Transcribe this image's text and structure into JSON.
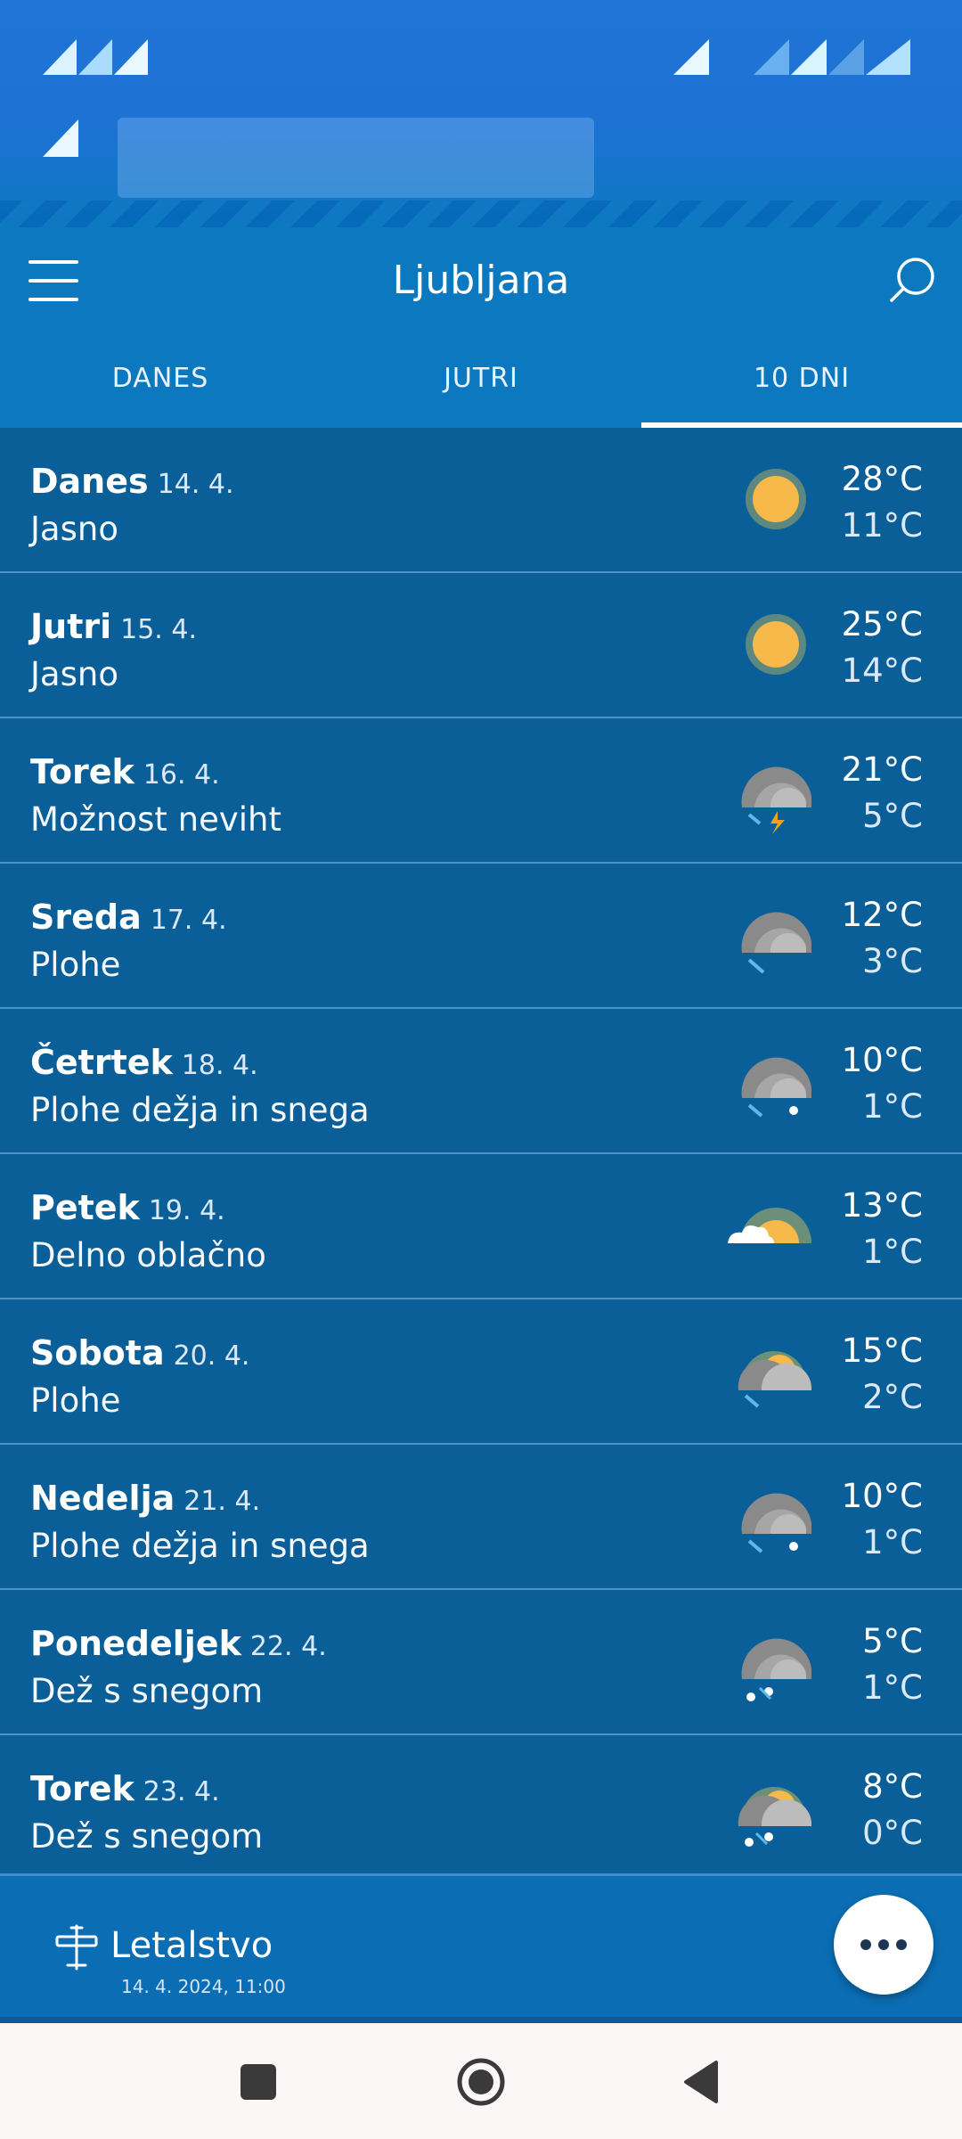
{
  "header": {
    "title": "Ljubljana"
  },
  "tabs": [
    {
      "label": "DANES",
      "active": false
    },
    {
      "label": "JUTRI",
      "active": false
    },
    {
      "label": "10 DNI",
      "active": true
    }
  ],
  "days": [
    {
      "day": "Danes",
      "date": "14. 4.",
      "desc": "Jasno",
      "icon": "sun-icon",
      "hi": "28°C",
      "lo": "11°C"
    },
    {
      "day": "Jutri",
      "date": "15. 4.",
      "desc": "Jasno",
      "icon": "sun-icon",
      "hi": "25°C",
      "lo": "14°C"
    },
    {
      "day": "Torek",
      "date": "16. 4.",
      "desc": "Možnost neviht",
      "icon": "thunderstorm-icon",
      "hi": "21°C",
      "lo": "5°C"
    },
    {
      "day": "Sreda",
      "date": "17. 4.",
      "desc": "Plohe",
      "icon": "rain-showers-icon",
      "hi": "12°C",
      "lo": "3°C"
    },
    {
      "day": "Četrtek",
      "date": "18. 4.",
      "desc": "Plohe dežja in snega",
      "icon": "rain-snow-showers-icon",
      "hi": "10°C",
      "lo": "1°C"
    },
    {
      "day": "Petek",
      "date": "19. 4.",
      "desc": "Delno oblačno",
      "icon": "partly-cloudy-icon",
      "hi": "13°C",
      "lo": "1°C"
    },
    {
      "day": "Sobota",
      "date": "20. 4.",
      "desc": "Plohe",
      "icon": "sun-cloud-rain-icon",
      "hi": "15°C",
      "lo": "2°C"
    },
    {
      "day": "Nedelja",
      "date": "21. 4.",
      "desc": "Plohe dežja in snega",
      "icon": "rain-snow-showers-icon",
      "hi": "10°C",
      "lo": "1°C"
    },
    {
      "day": "Ponedeljek",
      "date": "22. 4.",
      "desc": "Dež s snegom",
      "icon": "sleet-icon",
      "hi": "5°C",
      "lo": "1°C"
    },
    {
      "day": "Torek",
      "date": "23. 4.",
      "desc": "Dež s snegom",
      "icon": "sun-cloud-sleet-icon",
      "hi": "8°C",
      "lo": "0°C"
    }
  ],
  "footer": {
    "label": "Letalstvo",
    "timestamp": "14. 4. 2024, 11:00"
  },
  "colors": {
    "header_bg": "#0b78bf",
    "list_bg": "#0b5f99",
    "accent_white": "#ffffff",
    "sun": "#f6b94a"
  }
}
